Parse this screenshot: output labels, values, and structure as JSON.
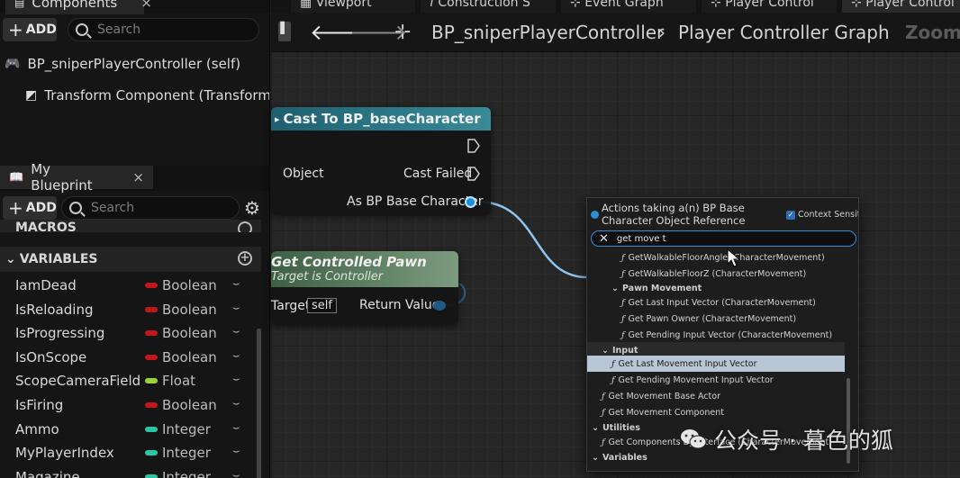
{
  "components_panel": {
    "tab_label": "Components",
    "add_label": "ADD",
    "search_placeholder": "Search",
    "items": [
      {
        "label": "BP_sniperPlayerController (self)"
      },
      {
        "label": "Transform Component (TransformCo"
      }
    ]
  },
  "blueprint_panel": {
    "tab_label": "My Blueprint",
    "add_label": "ADD",
    "search_placeholder": "Search",
    "macros_label": "MACROS",
    "variables_label": "VARIABLES",
    "variables": [
      {
        "name": "IamDead",
        "type": "Boolean",
        "color": "#c01818"
      },
      {
        "name": "IsReloading",
        "type": "Boolean",
        "color": "#c01818"
      },
      {
        "name": "IsProgressing",
        "type": "Boolean",
        "color": "#c01818"
      },
      {
        "name": "IsOnScope",
        "type": "Boolean",
        "color": "#c01818"
      },
      {
        "name": "ScopeCameraField",
        "type": "Float",
        "color": "#9ad43a"
      },
      {
        "name": "IsFiring",
        "type": "Boolean",
        "color": "#c01818"
      },
      {
        "name": "Ammo",
        "type": "Integer",
        "color": "#2bc7a4"
      },
      {
        "name": "MyPlayerIndex",
        "type": "Integer",
        "color": "#2bc7a4"
      },
      {
        "name": "Magazine",
        "type": "Integer",
        "color": "#2bc7a4"
      }
    ]
  },
  "doc_tabs": [
    "Viewport",
    "Construction S",
    "Event Graph",
    "Player Control",
    "Player Control"
  ],
  "breadcrumb": {
    "blueprint": "BP_sniperPlayerController",
    "separator": "›",
    "graph": "Player Controller Graph",
    "zoom": "Zoom"
  },
  "nodes": {
    "cast": {
      "title": "Cast To BP_baseCharacter",
      "object_pin": "Object",
      "cast_failed_pin": "Cast Failed",
      "as_pin": "As BP Base Character"
    },
    "get_pawn": {
      "title": "Get Controlled Pawn",
      "subtitle": "Target is Controller",
      "target_pin": "Target",
      "self_label": "self",
      "return_pin": "Return Value"
    }
  },
  "context_menu": {
    "title": "Actions taking a(n) BP Base Character Object Reference",
    "context_sensitive_label": "Context Sensitive",
    "search_value": "get move t",
    "rows": [
      {
        "label": "GetWalkableFloorAngle (CharacterMovement)",
        "kind": "func",
        "indent": 3
      },
      {
        "label": "GetWalkableFloorZ (CharacterMovement)",
        "kind": "func",
        "indent": 3
      },
      {
        "label": "Pawn Movement",
        "kind": "cat",
        "indent": 2
      },
      {
        "label": "Get Last Input Vector (CharacterMovement)",
        "kind": "func",
        "indent": 3
      },
      {
        "label": "Get Pawn Owner (CharacterMovement)",
        "kind": "func",
        "indent": 3
      },
      {
        "label": "Get Pending Input Vector (CharacterMovement)",
        "kind": "func",
        "indent": 3
      },
      {
        "label": "Input",
        "kind": "cat",
        "indent": 1
      },
      {
        "label": "Get Last Movement Input Vector",
        "kind": "func",
        "indent": 2,
        "selected": true
      },
      {
        "label": "Get Pending Movement Input Vector",
        "kind": "func",
        "indent": 2
      },
      {
        "label": "Get Movement Base Actor",
        "kind": "func",
        "indent": 1
      },
      {
        "label": "Get Movement Component",
        "kind": "func",
        "indent": 1
      },
      {
        "label": "Utilities",
        "kind": "cat",
        "indent": 0
      },
      {
        "label": "Get Components By Interface (CharacterMovement)",
        "kind": "func",
        "indent": 1
      },
      {
        "label": "Variables",
        "kind": "cat",
        "indent": 0
      }
    ]
  },
  "watermark": {
    "text": "公众号 · 暮色的狐"
  }
}
